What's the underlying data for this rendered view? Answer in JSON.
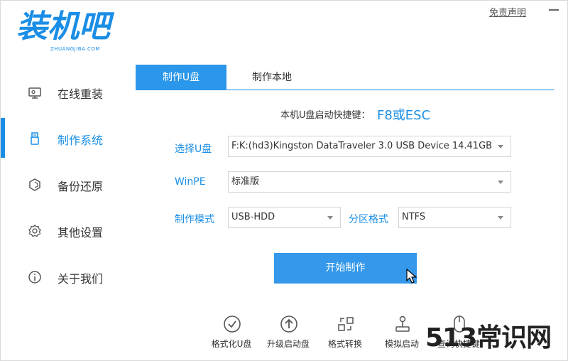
{
  "logo": {
    "title": "装机吧",
    "subtitle": "ZHUANGJIBA.COM"
  },
  "window": {
    "disclaimer": "免责声明"
  },
  "sidebar": {
    "items": [
      {
        "label": "在线重装",
        "icon": "monitor-icon"
      },
      {
        "label": "制作系统",
        "icon": "usb-icon"
      },
      {
        "label": "备份还原",
        "icon": "backup-icon"
      },
      {
        "label": "其他设置",
        "icon": "gear-icon"
      },
      {
        "label": "关于我们",
        "icon": "info-icon"
      }
    ],
    "active_index": 1
  },
  "tabs": [
    {
      "label": "制作U盘"
    },
    {
      "label": "制作本地"
    }
  ],
  "hotkey": {
    "label": "本机U盘启动快捷键：",
    "value": "F8或ESC"
  },
  "form": {
    "usb": {
      "label": "选择U盘",
      "value": "F:K:(hd3)Kingston DataTraveler 3.0 USB Device 14.41GB"
    },
    "winpe": {
      "label": "WinPE",
      "value": "标准版"
    },
    "mode": {
      "label": "制作模式",
      "value": "USB-HDD"
    },
    "partition": {
      "label": "分区格式",
      "value": "NTFS"
    }
  },
  "start_button": "开始制作",
  "tools": [
    {
      "label": "格式化U盘",
      "icon": "check-circle-icon"
    },
    {
      "label": "升级启动盘",
      "icon": "upload-circle-icon"
    },
    {
      "label": "格式转换",
      "icon": "convert-icon"
    },
    {
      "label": "模拟启动",
      "icon": "joystick-icon"
    },
    {
      "label": "查询快捷键",
      "icon": "mouse-icon"
    }
  ],
  "watermark": "513常识网",
  "colors": {
    "accent": "#1a8ee6",
    "button": "#3598ea"
  }
}
